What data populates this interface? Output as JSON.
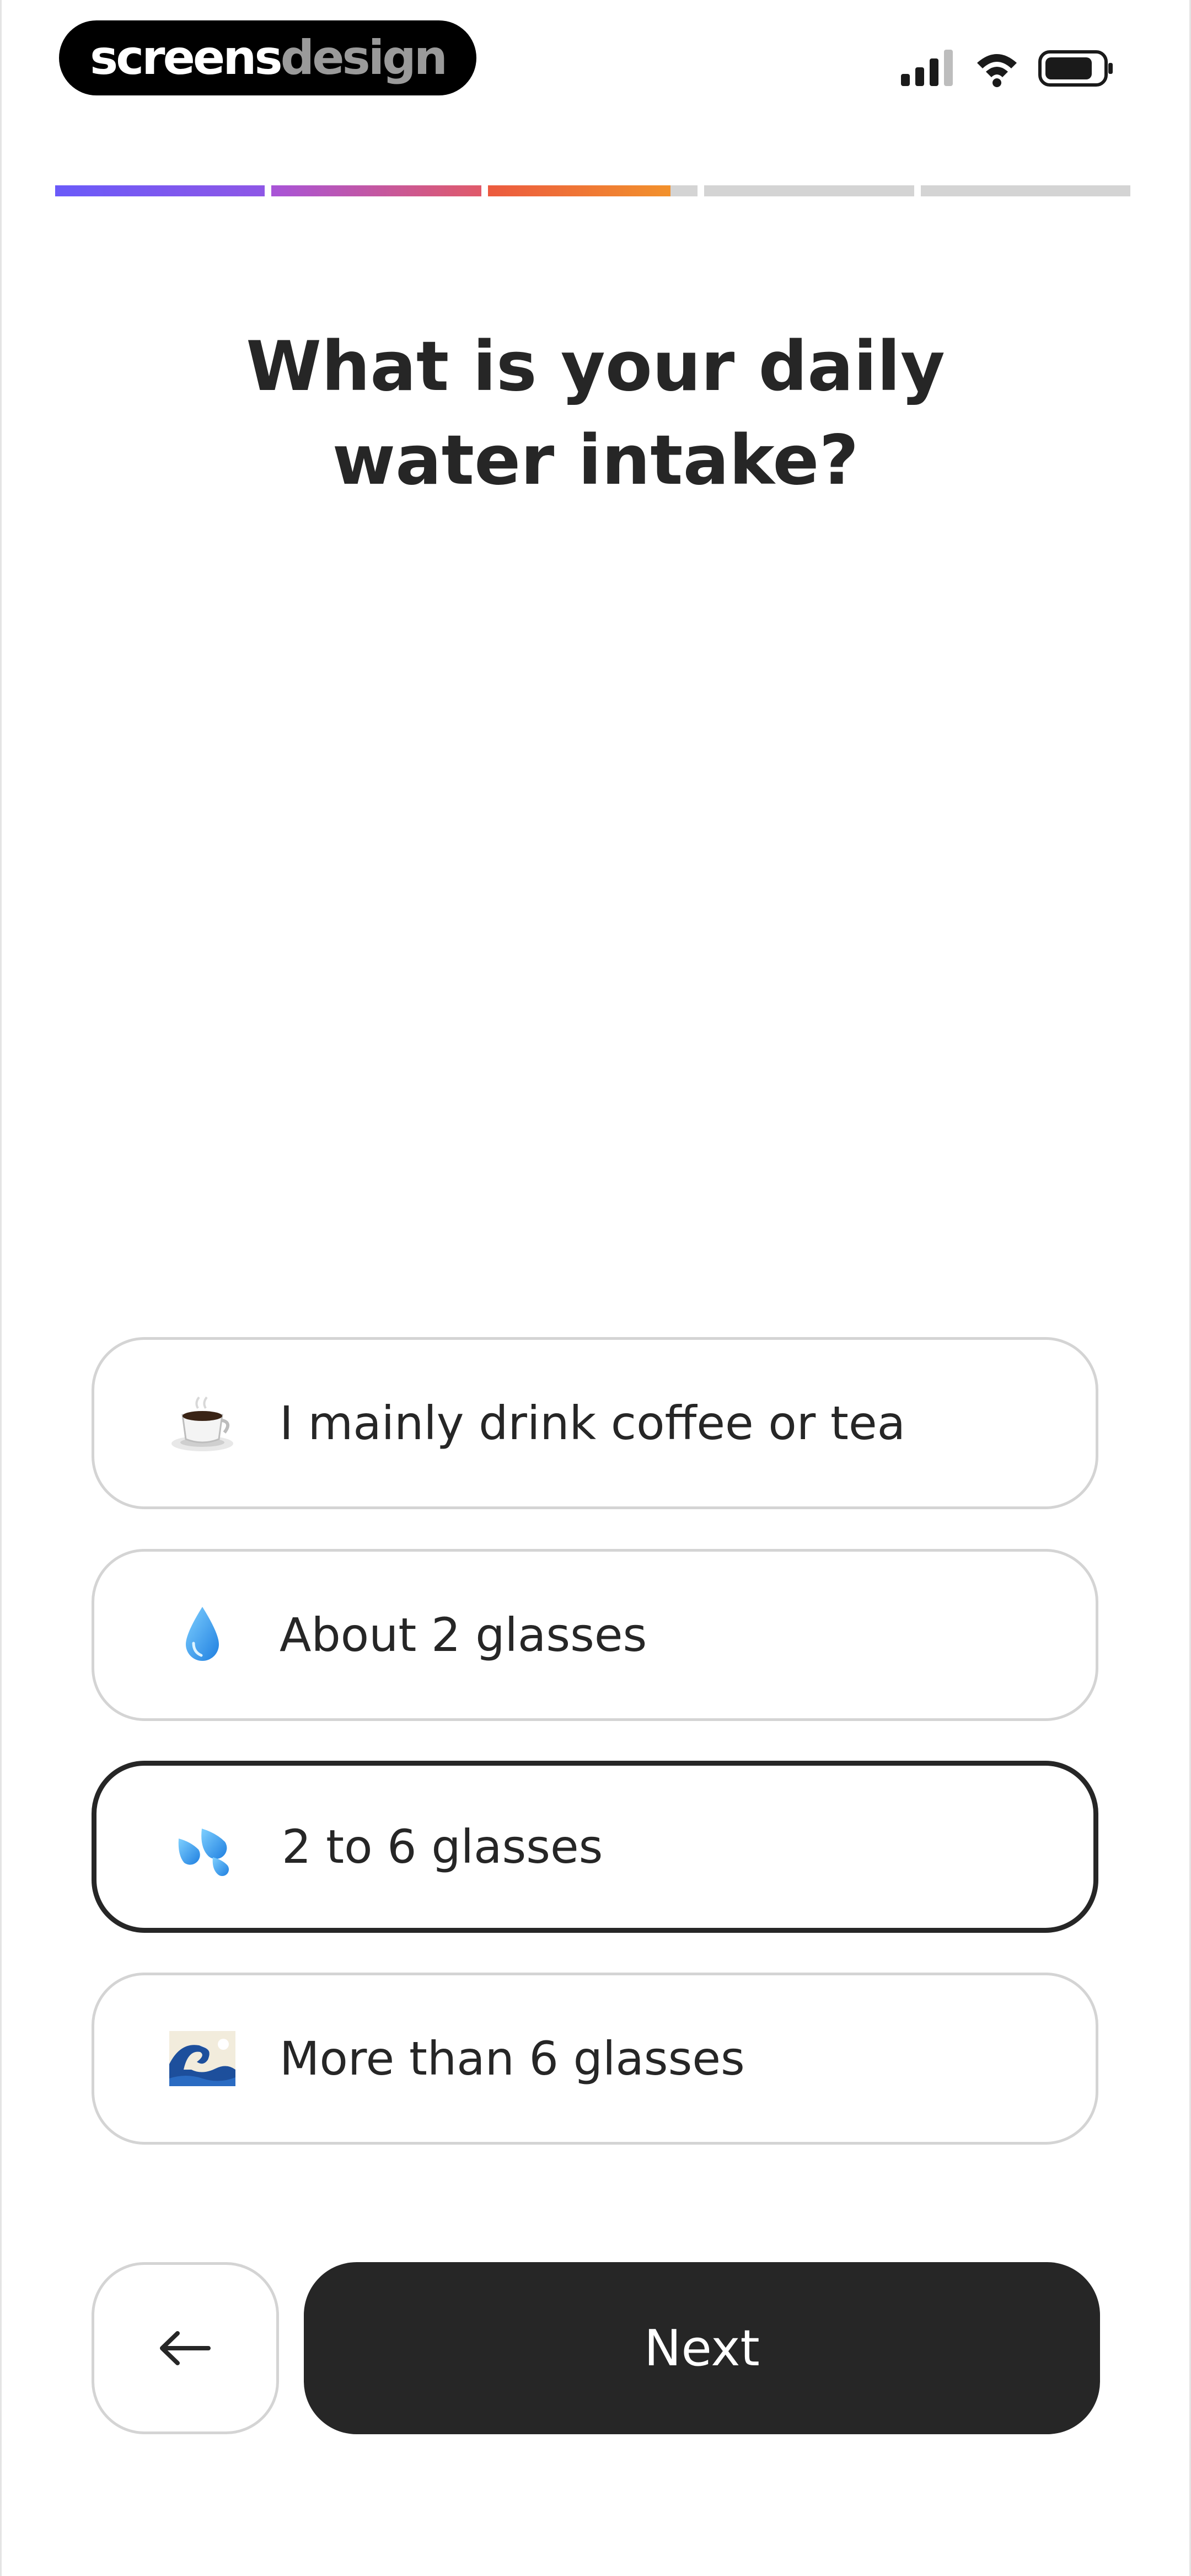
{
  "brand": {
    "part1": "screens",
    "part2": "design"
  },
  "status_bar": {
    "signal_icon": "signal-bars-icon",
    "wifi_icon": "wifi-icon",
    "battery_icon": "battery-icon"
  },
  "progress": {
    "segments": [
      {
        "fill": 1.0,
        "color_from": "#6a5af9",
        "color_to": "#8e57e6"
      },
      {
        "fill": 1.0,
        "color_from": "#a854d8",
        "color_to": "#e05a6a"
      },
      {
        "fill": 0.87,
        "color_from": "#ec5a3f",
        "color_to": "#f2912c"
      },
      {
        "fill": 0.0
      },
      {
        "fill": 0.0
      }
    ],
    "track_color": "#d4d4d4"
  },
  "question": {
    "title": "What is your daily\nwater intake?"
  },
  "options": [
    {
      "label": "I mainly drink coffee or tea",
      "icon": "coffee-cup-icon",
      "selected": false
    },
    {
      "label": "About 2 glasses",
      "icon": "water-drop-icon",
      "selected": false
    },
    {
      "label": "2 to 6 glasses",
      "icon": "splashing-drops-icon",
      "selected": true
    },
    {
      "label": "More than 6 glasses",
      "icon": "ocean-wave-icon",
      "selected": false
    }
  ],
  "actions": {
    "back_icon": "arrow-left-icon",
    "next_label": "Next"
  },
  "colors": {
    "text": "#262626",
    "button_dark": "#262626",
    "border": "#d4d4d4"
  }
}
